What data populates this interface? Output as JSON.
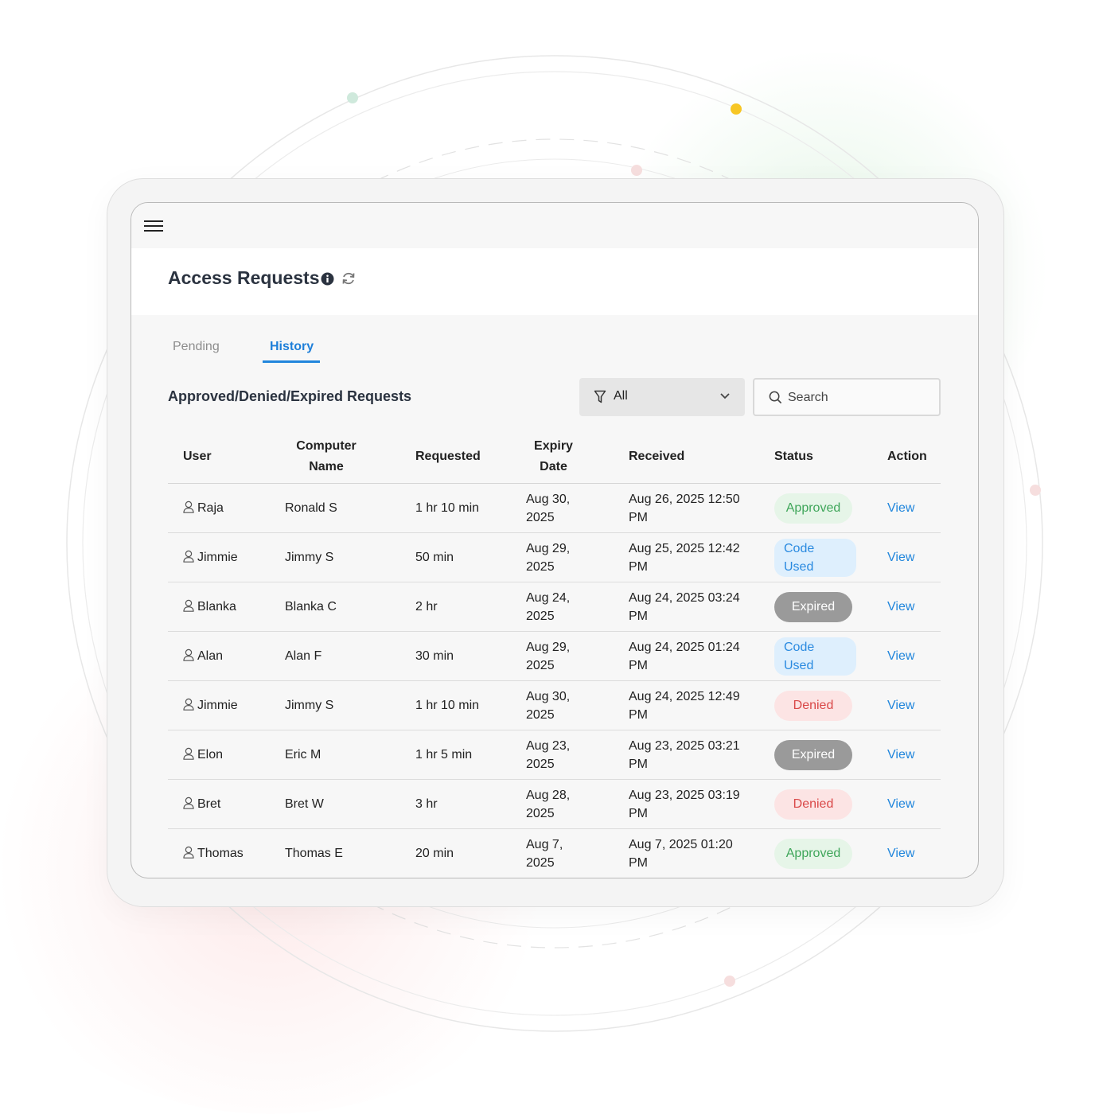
{
  "topbar": {
    "menu_icon": "hamburger-icon"
  },
  "page": {
    "title": "Access Requests",
    "info_icon": "info-icon",
    "refresh_icon": "refresh-icon"
  },
  "tabs": [
    {
      "label": "Pending",
      "active": false
    },
    {
      "label": "History",
      "active": true
    }
  ],
  "section_title": "Approved/Denied/Expired Requests",
  "filter": {
    "icon": "filter-icon",
    "value": "All"
  },
  "search": {
    "icon": "search-icon",
    "placeholder": "Search"
  },
  "table": {
    "headers": {
      "user": "User",
      "computer_line1": "Computer",
      "computer_line2": "Name",
      "requested": "Requested",
      "expiry_line1": "Expiry",
      "expiry_line2": "Date",
      "received": "Received",
      "status": "Status",
      "action": "Action"
    },
    "rows": [
      {
        "user": "Raja",
        "computer": "Ronald S",
        "requested": "1 hr 10 min",
        "expiry": "Aug 30, 2025",
        "received": "Aug 26, 2025 12:50 PM",
        "status": "Approved",
        "status_type": "approved",
        "action": "View"
      },
      {
        "user": "Jimmie",
        "computer": "Jimmy S",
        "requested": "50 min",
        "expiry": "Aug 29, 2025",
        "received": "Aug 25, 2025 12:42 PM",
        "status": "Code Used",
        "status_type": "code",
        "action": "View"
      },
      {
        "user": "Blanka",
        "computer": "Blanka C",
        "requested": "2 hr",
        "expiry": "Aug 24, 2025",
        "received": "Aug 24, 2025 03:24 PM",
        "status": "Expired",
        "status_type": "expired",
        "action": "View"
      },
      {
        "user": "Alan",
        "computer": "Alan F",
        "requested": "30 min",
        "expiry": "Aug 29, 2025",
        "received": "Aug 24, 2025 01:24 PM",
        "status": "Code Used",
        "status_type": "code",
        "action": "View"
      },
      {
        "user": "Jimmie",
        "computer": "Jimmy S",
        "requested": "1 hr 10 min",
        "expiry": "Aug 30, 2025",
        "received": "Aug 24, 2025 12:49 PM",
        "status": "Denied",
        "status_type": "denied",
        "action": "View"
      },
      {
        "user": "Elon",
        "computer": "Eric M",
        "requested": "1 hr 5 min",
        "expiry": "Aug 23, 2025",
        "received": "Aug 23, 2025 03:21 PM",
        "status": "Expired",
        "status_type": "expired",
        "action": "View"
      },
      {
        "user": "Bret",
        "computer": "Bret W",
        "requested": "3 hr",
        "expiry": "Aug 28, 2025",
        "received": "Aug 23, 2025 03:19 PM",
        "status": "Denied",
        "status_type": "denied",
        "action": "View"
      },
      {
        "user": "Thomas",
        "computer": "Thomas E",
        "requested": "20 min",
        "expiry": "Aug 7, 2025",
        "received": "Aug 7, 2025 01:20 PM",
        "status": "Approved",
        "status_type": "approved",
        "action": "View"
      }
    ]
  },
  "colors": {
    "accent": "#2186dc",
    "approved": "#3fa65a",
    "denied": "#d94848",
    "expired": "#9a9a9a",
    "code_used": "#2a8ae0"
  }
}
